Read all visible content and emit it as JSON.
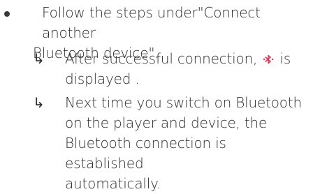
{
  "bullet": {
    "marker": "•",
    "text_line1": "Follow the steps under\"Connect another",
    "text_line2": "Bluetooth device\"."
  },
  "sub_items": [
    {
      "arrow": "↳",
      "line1_before_icon": "After successful connection,",
      "icon": "bluetooth-icon",
      "line1_after_icon": "is",
      "line2": "displayed ."
    },
    {
      "arrow": "↳",
      "line1": "Next time you switch on Bluetooth",
      "line2": "on the player and device, the",
      "line3": "Bluetooth connection is established",
      "line4": "automatically."
    }
  ],
  "colors": {
    "text": "#2b2b2b",
    "icon": "#e0365a"
  }
}
